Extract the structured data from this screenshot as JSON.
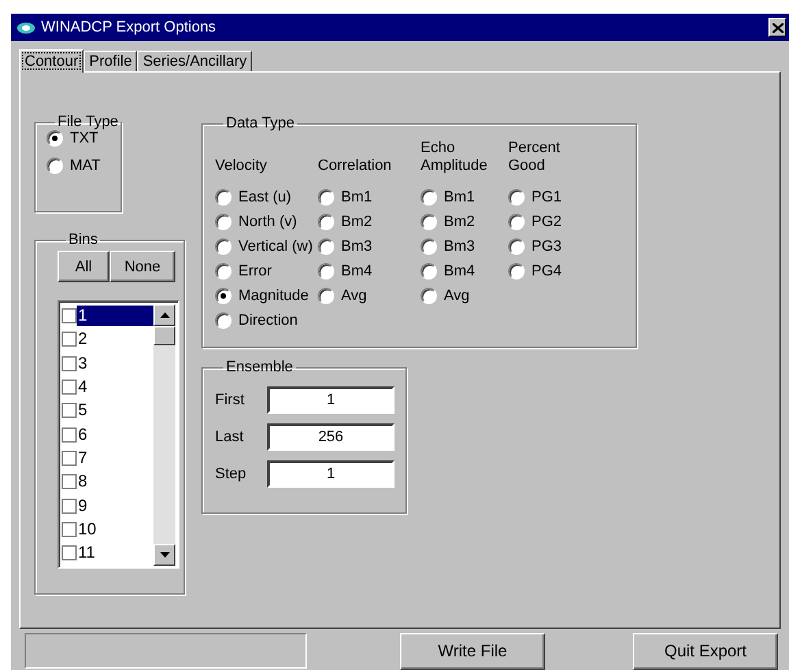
{
  "window": {
    "title": "WINADCP Export Options"
  },
  "tabs": [
    {
      "label": "Contour",
      "selected": true
    },
    {
      "label": "Profile",
      "selected": false
    },
    {
      "label": "Series/Ancillary",
      "selected": false
    }
  ],
  "file_type": {
    "title": "File Type",
    "options": [
      {
        "label": "TXT",
        "selected": true
      },
      {
        "label": "MAT",
        "selected": false
      }
    ]
  },
  "bins": {
    "title": "Bins",
    "buttons": [
      "All",
      "None"
    ],
    "items": [
      {
        "label": "1",
        "checked": false,
        "selected": true
      },
      {
        "label": "2",
        "checked": false,
        "selected": false
      },
      {
        "label": "3",
        "checked": false,
        "selected": false
      },
      {
        "label": "4",
        "checked": false,
        "selected": false
      },
      {
        "label": "5",
        "checked": false,
        "selected": false
      },
      {
        "label": "6",
        "checked": false,
        "selected": false
      },
      {
        "label": "7",
        "checked": false,
        "selected": false
      },
      {
        "label": "8",
        "checked": false,
        "selected": false
      },
      {
        "label": "9",
        "checked": false,
        "selected": false
      },
      {
        "label": "10",
        "checked": false,
        "selected": false
      },
      {
        "label": "11",
        "checked": false,
        "selected": false
      }
    ]
  },
  "data_type": {
    "title": "Data Type",
    "columns": [
      {
        "heading": "Velocity",
        "options": [
          {
            "label": "East (u)",
            "selected": false
          },
          {
            "label": "North (v)",
            "selected": false
          },
          {
            "label": "Vertical (w)",
            "selected": false
          },
          {
            "label": "Error",
            "selected": false
          },
          {
            "label": "Magnitude",
            "selected": true
          },
          {
            "label": "Direction",
            "selected": false
          }
        ]
      },
      {
        "heading": "Correlation",
        "options": [
          {
            "label": "Bm1",
            "selected": false
          },
          {
            "label": "Bm2",
            "selected": false
          },
          {
            "label": "Bm3",
            "selected": false
          },
          {
            "label": "Bm4",
            "selected": false
          },
          {
            "label": "Avg",
            "selected": false
          }
        ]
      },
      {
        "heading": "Echo Amplitude",
        "options": [
          {
            "label": "Bm1",
            "selected": false
          },
          {
            "label": "Bm2",
            "selected": false
          },
          {
            "label": "Bm3",
            "selected": false
          },
          {
            "label": "Bm4",
            "selected": false
          },
          {
            "label": "Avg",
            "selected": false
          }
        ]
      },
      {
        "heading": "Percent Good",
        "options": [
          {
            "label": "PG1",
            "selected": false
          },
          {
            "label": "PG2",
            "selected": false
          },
          {
            "label": "PG3",
            "selected": false
          },
          {
            "label": "PG4",
            "selected": false
          }
        ]
      }
    ]
  },
  "ensemble": {
    "title": "Ensemble",
    "fields": [
      {
        "label": "First",
        "value": "1"
      },
      {
        "label": "Last",
        "value": "256"
      },
      {
        "label": "Step",
        "value": "1"
      }
    ]
  },
  "buttons": [
    "Write File",
    "Quit Export"
  ]
}
